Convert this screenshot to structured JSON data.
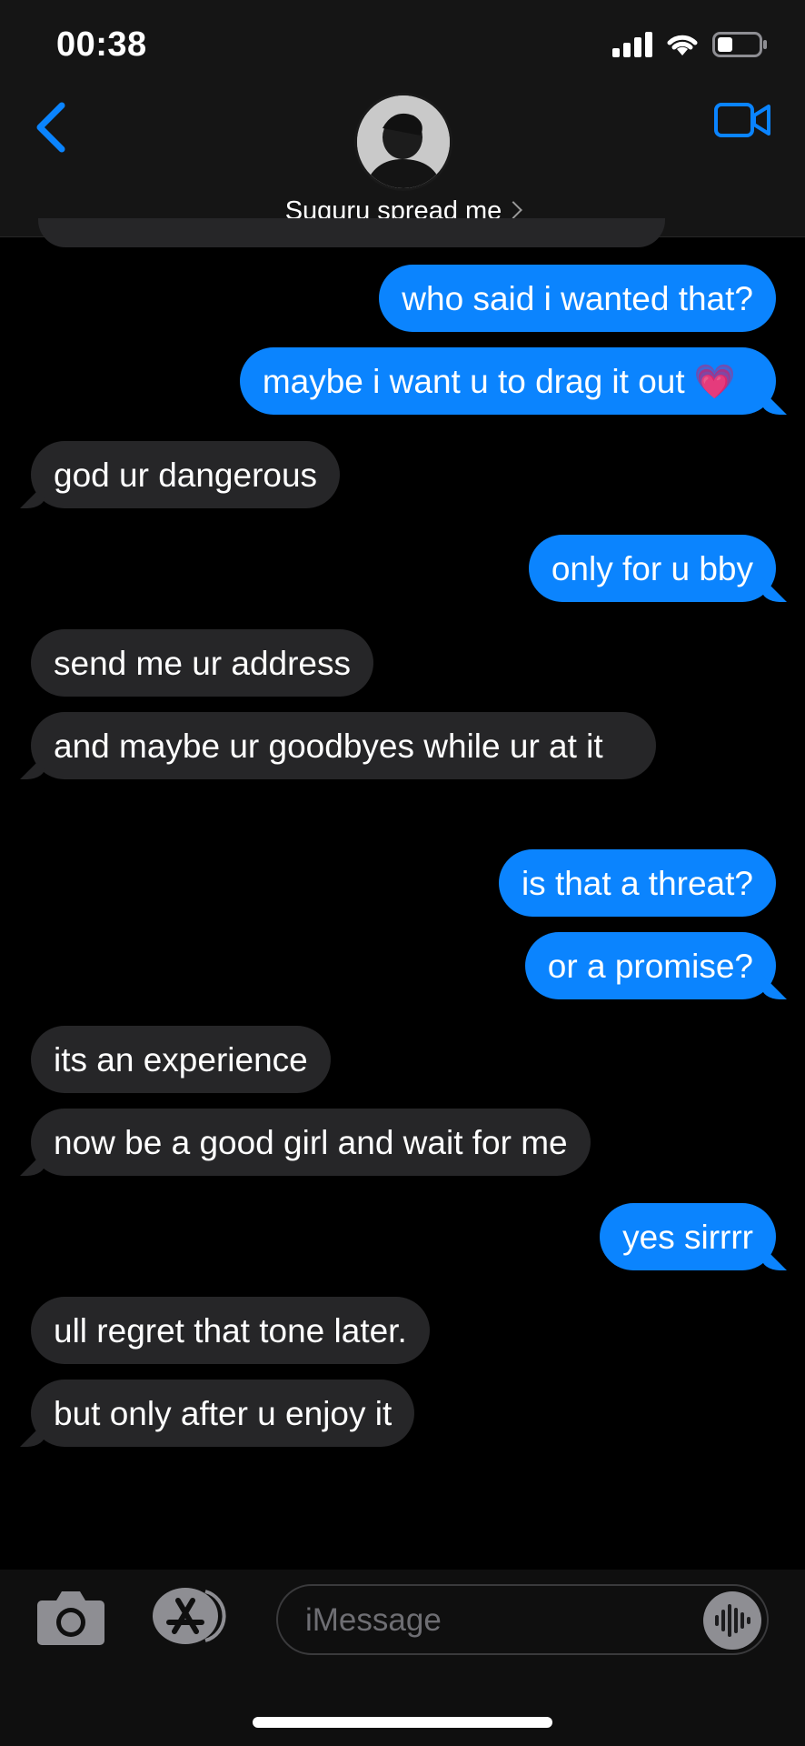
{
  "status_bar": {
    "time": "00:38"
  },
  "header": {
    "contact_name": "Suguru spread me"
  },
  "messages": [
    {
      "dir": "out",
      "text": "who said i wanted that?"
    },
    {
      "dir": "out",
      "text": "maybe i want u to drag it out 💗"
    },
    {
      "dir": "in",
      "text": "god ur dangerous"
    },
    {
      "dir": "out",
      "text": "only for u bby"
    },
    {
      "dir": "in",
      "text": "send me ur address"
    },
    {
      "dir": "in",
      "text": "and maybe ur goodbyes while ur at it"
    },
    {
      "dir": "out",
      "text": "is that a threat?"
    },
    {
      "dir": "out",
      "text": "or a promise?"
    },
    {
      "dir": "in",
      "text": "its an experience"
    },
    {
      "dir": "in",
      "text": "now be a good girl and wait for me"
    },
    {
      "dir": "out",
      "text": "yes sirrrr"
    },
    {
      "dir": "in",
      "text": "ull regret that tone later."
    },
    {
      "dir": "in",
      "text": "but only after u enjoy it"
    }
  ],
  "composer": {
    "placeholder": "iMessage"
  },
  "colors": {
    "outgoing": "#0b84fe",
    "incoming": "#262628",
    "accent": "#0a84ff"
  },
  "icons": [
    "back-chevron-icon",
    "video-call-icon",
    "camera-icon",
    "app-store-icon",
    "audio-waveform-icon"
  ]
}
